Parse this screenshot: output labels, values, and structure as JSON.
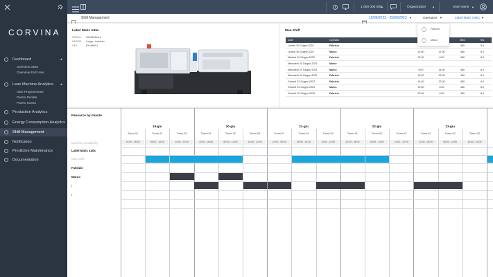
{
  "sidebar": {
    "logo": "CORVINA",
    "items": [
      {
        "label": "Dashboard",
        "expandable": true,
        "subs": [
          "Overview OEM",
          "Overview End User"
        ]
      },
      {
        "label": "Lean Machine Analytics",
        "expandable": true,
        "subs": [
          "OEE Programmate",
          "Pareto Perdite",
          "Pareto Scarto"
        ]
      },
      {
        "label": "Production Analytics",
        "expandable": false,
        "subs": []
      },
      {
        "label": "Energy Consumption Analytics",
        "expandable": false,
        "subs": []
      },
      {
        "label": "Shift Management",
        "expandable": false,
        "subs": [],
        "active": true
      },
      {
        "label": "Notification",
        "expandable": false,
        "subs": []
      },
      {
        "label": "Predictive Maintenance",
        "expandable": false,
        "subs": []
      },
      {
        "label": "Documentation",
        "expandable": false,
        "subs": []
      }
    ]
  },
  "header": {
    "count": "1 000 000 000",
    "organization": "Organization",
    "username": "User name"
  },
  "toolbar": {
    "title": "Shift Management",
    "date_range": "19/06/2023 - 25/06/2023",
    "operators_label": "Operators",
    "machine_label": "Label Matic X45C"
  },
  "machine": {
    "title": "Label Matic X45x",
    "info": [
      {
        "key": "SERIAL:",
        "value": "1004394KA.b"
      },
      {
        "key": "WHERE:",
        "value": "Luogo - Indirizzo"
      },
      {
        "key": "OEE:",
        "value": "Ext 9990.4"
      }
    ]
  },
  "shift": {
    "title": "Man Shift",
    "columns": [
      "Date",
      "Operator",
      "Start",
      "End",
      "Mins",
      "Hrs"
    ],
    "rows": [
      [
        "Lunedì 19 Giugno 2023",
        "Fabrizio",
        "",
        "",
        "480",
        "8.0"
      ],
      [
        "Lunedì 19 Giugno 2023",
        "Marco",
        "14:00",
        "22:00",
        "480",
        "8.0"
      ],
      [
        "Martedì 20 Giugno 2023",
        "Fabrizio",
        "22:00",
        "6:00",
        "480",
        "8.0"
      ],
      [
        "Mercoledì 20 Giugno 2023",
        "Marco",
        "",
        "",
        "",
        ""
      ],
      [
        "Mercoledì 21 Giugno 2023",
        "Marco",
        "6:00",
        "14:00",
        "480",
        "8.0"
      ],
      [
        "Mercoledì 21 Giugno 2023",
        "Fabrizio",
        "14:00",
        "22:00",
        "480",
        "8.0"
      ],
      [
        "Giovedì 22 Giugno 2023",
        "Fabrizio",
        "14:00",
        "22:00",
        "480",
        "8.0"
      ],
      [
        "Giovedì 22 Giugno 2023",
        "Marco",
        "22:00",
        "6:00",
        "480",
        "8.0"
      ],
      [
        "Giovedì 22 Giugno 2023",
        "Fabrizio",
        "22:00",
        "6:00",
        "480",
        "8.0"
      ]
    ]
  },
  "operators_dropdown": [
    "Fabrizio",
    "Marco"
  ],
  "resources": {
    "title": "Resource by minute",
    "row_labels": [
      "Machine availability",
      "Label Matic x45x",
      "Man Shift",
      "Fabrizio",
      "Marco",
      "/",
      "/"
    ],
    "days": [
      "19-giu",
      "20-giu",
      "21-giu",
      "22-giu",
      "23-giu"
    ],
    "turns": [
      "Turno 01",
      "Turno 02",
      "Turno 03"
    ],
    "times": [
      "22:00 - 06:00",
      "06:00 - 14:00",
      "14:00 - 22:00"
    ],
    "accent_color": "#1ca7dc",
    "dark_color": "#3b3f45",
    "machine_active": [
      0,
      1,
      1,
      1,
      1,
      0,
      0,
      1,
      1,
      1,
      1,
      0,
      0,
      0,
      0,
      1
    ],
    "fabrizio_active": [
      0,
      0,
      1,
      0,
      1,
      0,
      0,
      0,
      0,
      0,
      0,
      0,
      0,
      0,
      0,
      0
    ],
    "marco_active": [
      0,
      0,
      0,
      1,
      0,
      1,
      1,
      0,
      1,
      1,
      0,
      0,
      1,
      1,
      0,
      0
    ]
  }
}
